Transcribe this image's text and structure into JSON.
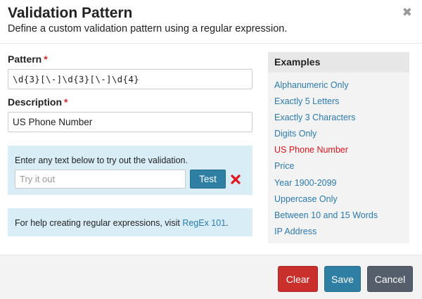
{
  "header": {
    "title": "Validation Pattern",
    "subtitle": "Define a custom validation pattern using a regular expression.",
    "close_icon": "close-icon"
  },
  "form": {
    "pattern_label": "Pattern",
    "pattern_value": "\\d{3}[\\-]\\d{3}[\\-]\\d{4}",
    "description_label": "Description",
    "description_value": "US Phone Number",
    "required_marker": "*"
  },
  "tester": {
    "instruction": "Enter any text below to try out the validation.",
    "placeholder": "Try it out",
    "test_label": "Test",
    "result_icon": "x-mark-icon",
    "result_color": "#e0151b"
  },
  "help": {
    "text_before": "For help creating regular expressions, visit ",
    "link_label": "RegEx 101",
    "text_after": "."
  },
  "examples": {
    "title": "Examples",
    "items": [
      {
        "label": "Alphanumeric Only",
        "active": false
      },
      {
        "label": "Exactly 5 Letters",
        "active": false
      },
      {
        "label": "Exactly 3 Characters",
        "active": false
      },
      {
        "label": "Digits Only",
        "active": false
      },
      {
        "label": "US Phone Number",
        "active": true
      },
      {
        "label": "Price",
        "active": false
      },
      {
        "label": "Year 1900-2099",
        "active": false
      },
      {
        "label": "Uppercase Only",
        "active": false
      },
      {
        "label": "Between 10 and 15 Words",
        "active": false
      },
      {
        "label": "IP Address",
        "active": false
      }
    ]
  },
  "footer": {
    "clear_label": "Clear",
    "save_label": "Save",
    "cancel_label": "Cancel"
  },
  "colors": {
    "primary": "#2f7ea3",
    "danger": "#c9302c",
    "secondary": "#555e6b",
    "link": "#2a7ab0",
    "info_bg": "#d9edf7"
  }
}
